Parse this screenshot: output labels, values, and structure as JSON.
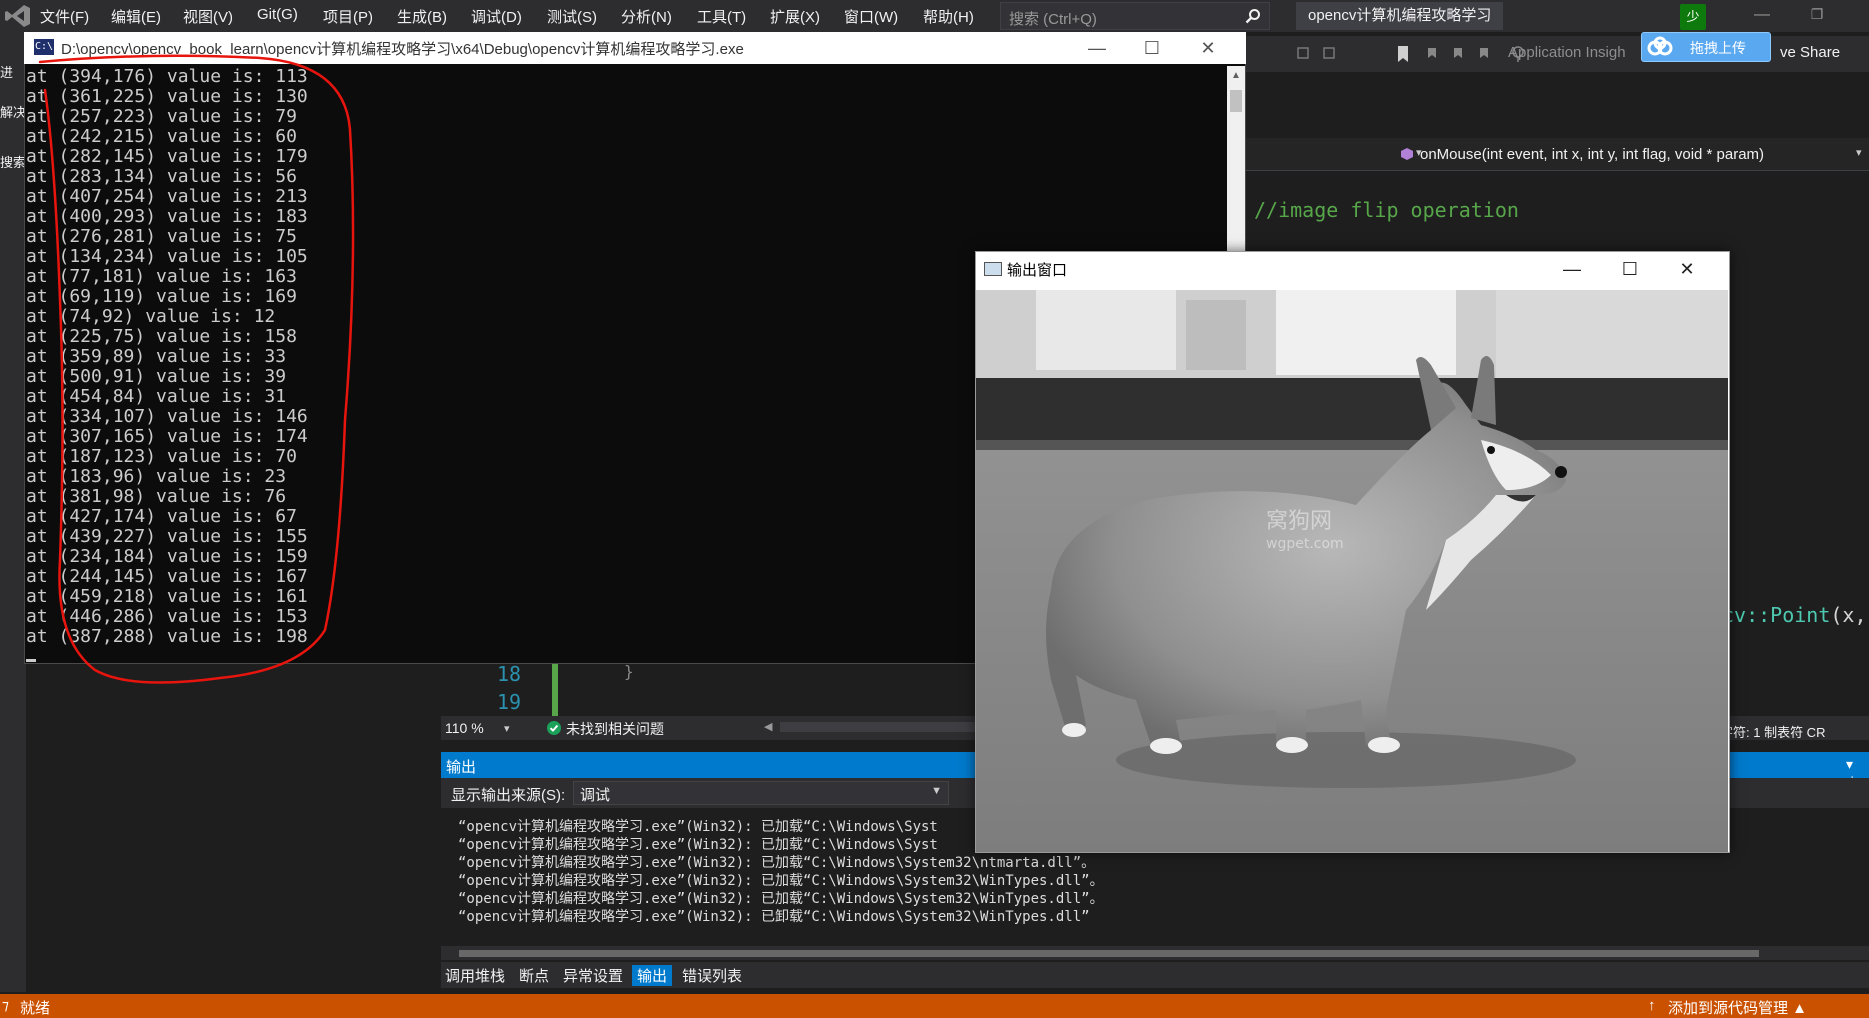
{
  "menu": [
    "文件(F)",
    "编辑(E)",
    "视图(V)",
    "Git(G)",
    "项目(P)",
    "生成(B)",
    "调试(D)",
    "测试(S)",
    "分析(N)",
    "工具(T)",
    "扩展(X)",
    "窗口(W)",
    "帮助(H)"
  ],
  "search": {
    "placeholder": "搜索 (Ctrl+Q)"
  },
  "solution_title": "opencv计算机编程攻略学习",
  "live_share_avatar": "少",
  "toolbar": {
    "app_insights": "Application Insigh",
    "live_share": "ve Share",
    "upload": "拖拽上传"
  },
  "editor": {
    "nav_function": "onMouse(int event, int x, int y, int flag, void * param)",
    "comment": "//image flip operation",
    "code_fragment_type": "cv::Point",
    "code_fragment_rest": "(x,",
    "line_numbers": [
      "18",
      "19"
    ],
    "brace": "}",
    "zoom": "110 %",
    "issues": "未找到相关问题",
    "status_right": "字符: 1    制表符    CR"
  },
  "output": {
    "title": "输出",
    "source_label": "显示输出来源(S):",
    "source_value": "调试",
    "lines": [
      "“opencv计算机编程攻略学习.exe”(Win32): 已加载“C:\\Windows\\Syst",
      "“opencv计算机编程攻略学习.exe”(Win32): 已加载“C:\\Windows\\Syst",
      "“opencv计算机编程攻略学习.exe”(Win32): 已加载“C:\\Windows\\System32\\ntmarta.dll”。",
      "“opencv计算机编程攻略学习.exe”(Win32): 已加载“C:\\Windows\\System32\\WinTypes.dll”。",
      "“opencv计算机编程攻略学习.exe”(Win32): 已加载“C:\\Windows\\System32\\WinTypes.dll”。",
      "“opencv计算机编程攻略学习.exe”(Win32): 已卸载“C:\\Windows\\System32\\WinTypes.dll”"
    ]
  },
  "bottom_tabs": [
    "调用堆栈",
    "断点",
    "异常设置",
    "输出",
    "错误列表"
  ],
  "active_bottom_tab": "输出",
  "left_sliver": [
    "进",
    "解决",
    "搜索"
  ],
  "status": {
    "ready": "就绪",
    "source_control": "添加到源代码管理 ▲"
  },
  "console": {
    "title": "D:\\opencv\\opencv_book_learn\\opencv计算机编程攻略学习\\x64\\Debug\\opencv计算机编程攻略学习.exe",
    "icon_text": "C:\\",
    "lines": [
      "at (394,176) value is: 113",
      "at (361,225) value is: 130",
      "at (257,223) value is: 79",
      "at (242,215) value is: 60",
      "at (282,145) value is: 179",
      "at (283,134) value is: 56",
      "at (407,254) value is: 213",
      "at (400,293) value is: 183",
      "at (276,281) value is: 75",
      "at (134,234) value is: 105",
      "at (77,181) value is: 163",
      "at (69,119) value is: 169",
      "at (74,92) value is: 12",
      "at (225,75) value is: 158",
      "at (359,89) value is: 33",
      "at (500,91) value is: 39",
      "at (454,84) value is: 31",
      "at (334,107) value is: 146",
      "at (307,165) value is: 174",
      "at (187,123) value is: 70",
      "at (183,96) value is: 23",
      "at (381,98) value is: 76",
      "at (427,174) value is: 67",
      "at (439,227) value is: 155",
      "at (234,184) value is: 159",
      "at (244,145) value is: 167",
      "at (459,218) value is: 161",
      "at (446,286) value is: 153",
      "at (387,288) value is: 198"
    ]
  },
  "image_window": {
    "title": "输出窗口",
    "watermark_cn": "窝狗网",
    "watermark_en": "wgpet.com"
  },
  "colors": {
    "vs_bg": "#1e1e1e",
    "vs_chrome": "#2d2d30",
    "accent": "#007acc",
    "status_orange": "#ca5100",
    "annotation_red": "#e8140e",
    "comment_green": "#57a64a"
  }
}
